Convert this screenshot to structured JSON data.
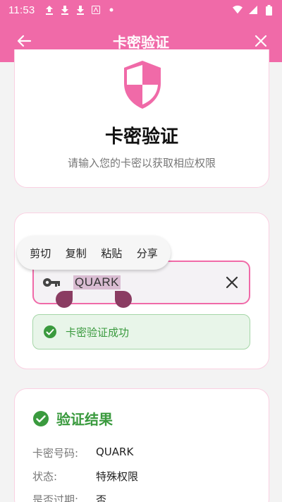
{
  "status_bar": {
    "time": "11:53"
  },
  "app_bar": {
    "title": "卡密验证"
  },
  "intro_card": {
    "heading": "卡密验证",
    "subtitle": "请输入您的卡密以获取相应权限"
  },
  "selection_menu": {
    "items": [
      "剪切",
      "复制",
      "粘贴",
      "分享"
    ]
  },
  "card_input": {
    "value": "QUARK"
  },
  "success_message": "卡密验证成功",
  "result": {
    "title": "验证结果",
    "rows": [
      {
        "label": "卡密号码:",
        "value": "QUARK"
      },
      {
        "label": "状态:",
        "value": "特殊权限"
      },
      {
        "label": "是否过期:",
        "value": "否"
      }
    ]
  },
  "colors": {
    "primary": "#f06aa8",
    "success": "#3a9a3e",
    "success_bg": "#e8f5e9"
  }
}
